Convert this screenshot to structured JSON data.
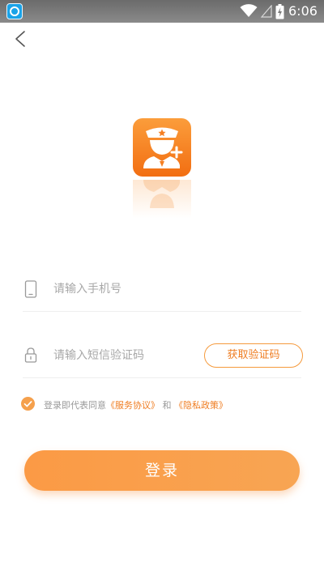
{
  "status_bar": {
    "time": "6:06",
    "icons": [
      "app-notification-icon",
      "wifi-icon",
      "signal-icon",
      "battery-charging-icon"
    ]
  },
  "header": {
    "back_icon": "chevron-left-icon"
  },
  "logo": {
    "icon": "police-officer-plus-icon",
    "colors": {
      "top": "#fb9d3b",
      "bottom": "#f26e12"
    }
  },
  "form": {
    "phone": {
      "placeholder": "请输入手机号",
      "value": "",
      "icon": "phone-icon"
    },
    "code": {
      "placeholder": "请输入短信验证码",
      "value": "",
      "icon": "lock-icon"
    },
    "get_code_label": "获取验证码"
  },
  "agreement": {
    "checked": true,
    "prefix": "登录即代表同意",
    "terms_link": "《服务协议》",
    "connector": "和",
    "privacy_link": "《隐私政策》"
  },
  "login_button": {
    "label": "登录"
  },
  "colors": {
    "accent": "#ef7d22",
    "button": "#fb9a45",
    "check": "#f5a04c",
    "placeholder": "#a8a8a8"
  }
}
